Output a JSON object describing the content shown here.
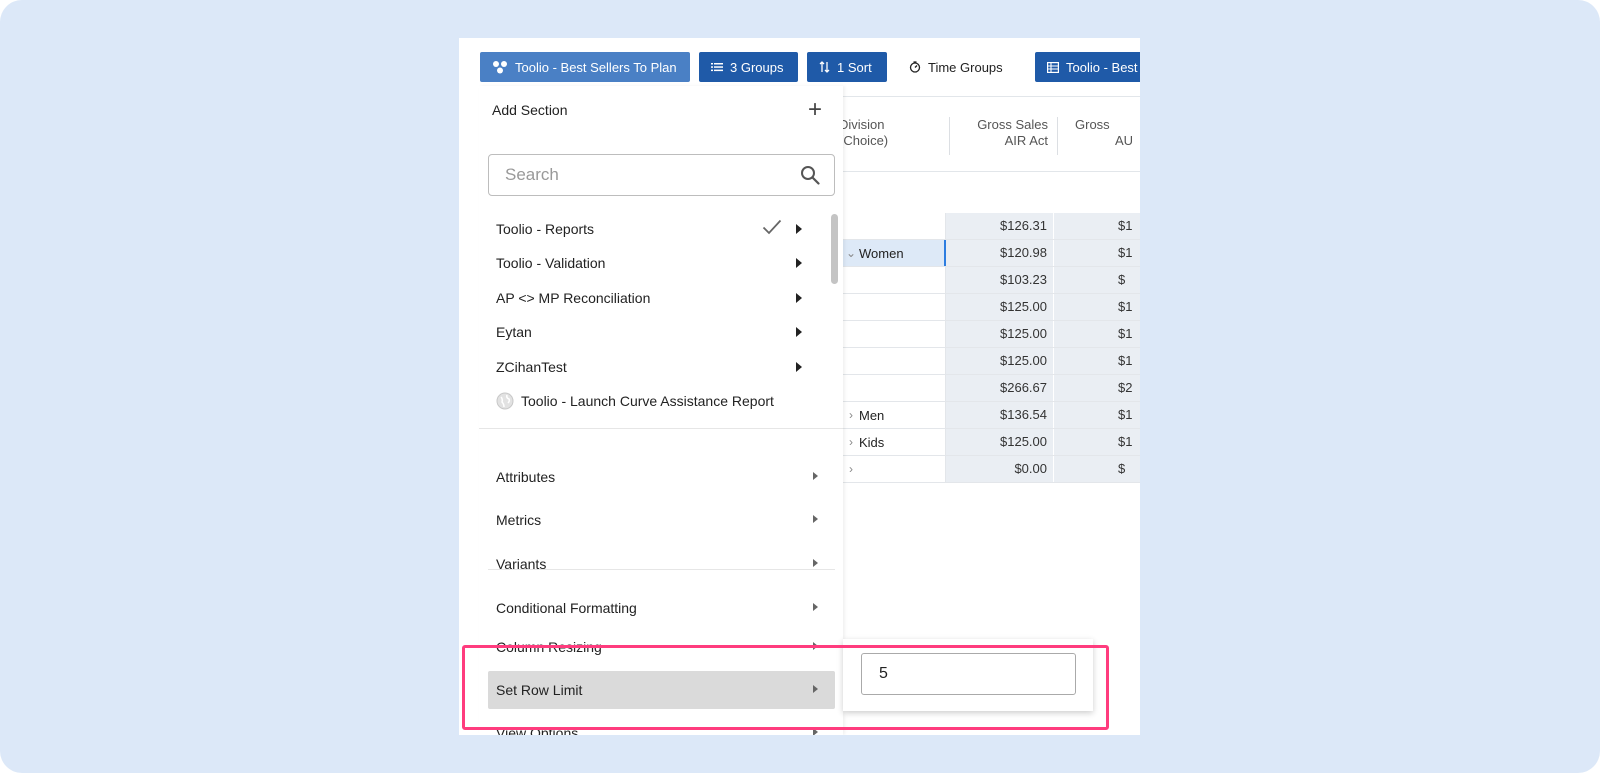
{
  "toolbar": {
    "view_label": "Toolio - Best Sellers To Plan",
    "groups_label": "3 Groups",
    "sort_label": "1 Sort",
    "time_groups_label": "Time Groups",
    "plan_label": "Toolio - Best"
  },
  "grid": {
    "col_division_line1": "Division",
    "col_division_line2": "(Choice)",
    "col_gross_line1": "Gross Sales",
    "col_gross_line2": "AIR Act",
    "col_gross2_line1": "Gross",
    "col_gross2_line2": "AU",
    "rows": [
      {
        "label": "",
        "v1": "$126.31",
        "v2": "$1"
      },
      {
        "label": "Women",
        "v1": "$120.98",
        "v2": "$1"
      },
      {
        "label": "",
        "v1": "$103.23",
        "v2": "$"
      },
      {
        "label": "",
        "v1": "$125.00",
        "v2": "$1"
      },
      {
        "label": "",
        "v1": "$125.00",
        "v2": "$1"
      },
      {
        "label": "",
        "v1": "$125.00",
        "v2": "$1"
      },
      {
        "label": "",
        "v1": "$266.67",
        "v2": "$2"
      },
      {
        "label": "Men",
        "v1": "$136.54",
        "v2": "$1"
      },
      {
        "label": "Kids",
        "v1": "$125.00",
        "v2": "$1"
      },
      {
        "label": "",
        "v1": "$0.00",
        "v2": "$"
      }
    ]
  },
  "menu": {
    "add_section": "Add Section",
    "search_placeholder": "Search",
    "sections": [
      {
        "label": "Toolio - Reports"
      },
      {
        "label": "Toolio - Validation"
      },
      {
        "label": "AP <> MP Reconciliation"
      },
      {
        "label": "Eytan"
      },
      {
        "label": "ZCihanTest"
      },
      {
        "label": "Toolio - Launch Curve Assistance Report"
      }
    ],
    "attributes": "Attributes",
    "metrics": "Metrics",
    "variants": "Variants",
    "conditional_formatting": "Conditional Formatting",
    "column_resizing": "Column Resizing",
    "set_row_limit": "Set Row Limit",
    "view_options": "View Options"
  },
  "row_limit": {
    "value": "5"
  },
  "colors": {
    "accent_dark": "#1f5aa8",
    "accent_light": "#4a80c5",
    "highlight": "#ff3c7e"
  }
}
